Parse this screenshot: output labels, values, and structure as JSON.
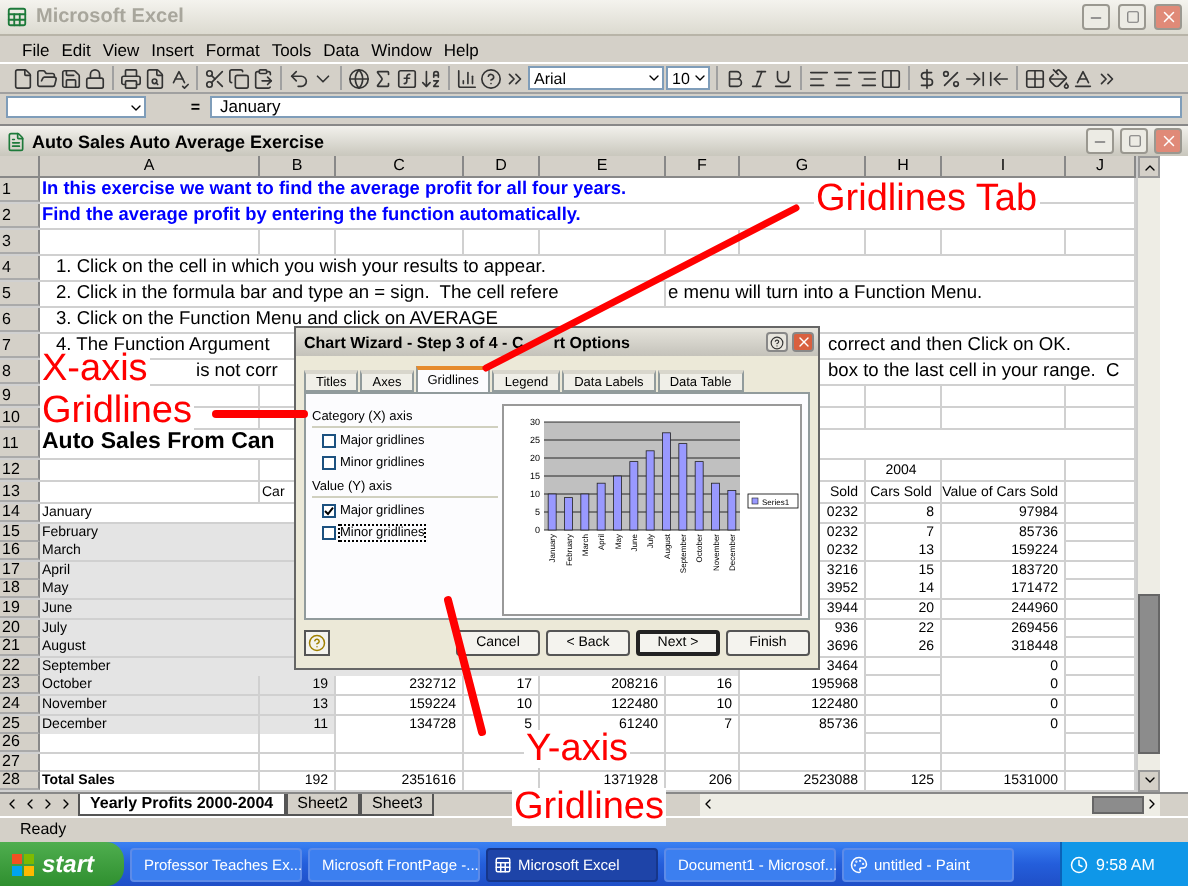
{
  "window": {
    "title": "Microsoft Excel"
  },
  "menu": [
    "File",
    "Edit",
    "View",
    "Insert",
    "Format",
    "Tools",
    "Data",
    "Window",
    "Help"
  ],
  "toolbar": {
    "font": "Arial",
    "size": "10"
  },
  "formula_bar": {
    "equals": "=",
    "value": "January"
  },
  "workbook": {
    "title": "Auto Sales Auto Average Exercise"
  },
  "columns": [
    "A",
    "B",
    "C",
    "D",
    "E",
    "F",
    "G",
    "H",
    "I",
    "J"
  ],
  "rows": [
    {
      "number": "1",
      "kind": "wide",
      "cells": [
        {
          "kind": "heading",
          "text": "In this exercise we want to find the average profit for all four years."
        }
      ]
    },
    {
      "number": "2",
      "kind": "wide",
      "cells": [
        {
          "kind": "heading",
          "text": "Find the average profit by entering the function automatically."
        }
      ]
    },
    {
      "number": "3",
      "kind": "wide"
    },
    {
      "number": "4",
      "kind": "wide",
      "cells": [
        {
          "kind": "step",
          "text": "1. Click on the cell in which you wish your results to appear."
        }
      ]
    },
    {
      "number": "5",
      "kind": "wide",
      "cells": [
        {
          "kind": "step",
          "text": "2. Click in the formula bar and type an = sign.  The cell refere"
        },
        {
          "kind": "blank"
        },
        {
          "kind": "blank"
        },
        {
          "kind": "blank"
        },
        {
          "kind": "blank"
        },
        {
          "kind": "tail",
          "text": "e menu will turn into a Function Menu."
        }
      ]
    },
    {
      "number": "6",
      "kind": "wide",
      "cells": [
        {
          "kind": "step",
          "text": "3. Click on the Function Menu and click on AVERAGE"
        }
      ]
    },
    {
      "number": "7",
      "kind": "wide",
      "cells": [
        {
          "kind": "step",
          "text": "4. The Function Argument"
        },
        {
          "kind": "blank"
        },
        {
          "kind": "blank"
        },
        {
          "kind": "blank"
        },
        {
          "kind": "blank"
        },
        {
          "kind": "blank"
        },
        {
          "kind": "after-dialog",
          "text": "correct and then Click on OK."
        }
      ]
    },
    {
      "number": "8",
      "kind": "wide",
      "cells": [
        {
          "kind": "after-label",
          "text": "is not corr"
        },
        {
          "kind": "blank"
        },
        {
          "kind": "blank"
        },
        {
          "kind": "blank"
        },
        {
          "kind": "blank"
        },
        {
          "kind": "blank"
        },
        {
          "kind": "after-dialog",
          "text": "box to the last cell in your range.  C"
        }
      ]
    },
    {
      "number": "9",
      "kind": "mid"
    },
    {
      "number": "10",
      "kind": "mid"
    },
    {
      "number": "11",
      "kind": "title",
      "cells": [
        {
          "kind": "title",
          "text": "Auto Sales From Can"
        }
      ]
    },
    {
      "number": "12",
      "kind": "mid",
      "cells": [
        {
          "kind": "blank"
        },
        {
          "kind": "blank"
        },
        {
          "kind": "blank"
        },
        {
          "kind": "blank"
        },
        {
          "kind": "blank"
        },
        {
          "kind": "blank"
        },
        {
          "kind": "blank"
        },
        {
          "kind": "center",
          "text": "2004"
        }
      ]
    },
    {
      "number": "13",
      "kind": "mid",
      "cells": [
        {
          "kind": "blank"
        },
        {
          "kind": "label",
          "text": "Car"
        },
        {
          "kind": "blank"
        },
        {
          "kind": "blank"
        },
        {
          "kind": "blank"
        },
        {
          "kind": "blank"
        },
        {
          "kind": "number",
          "text": "Sold"
        },
        {
          "kind": "center",
          "text": "Cars Sold"
        },
        {
          "kind": "number",
          "text": "Value of Cars Sold"
        }
      ]
    },
    {
      "number": "14",
      "kind": "data",
      "in_selection": false,
      "cells": [
        {
          "kind": "label",
          "text": "January"
        },
        {
          "kind": "blank"
        },
        {
          "kind": "blank"
        },
        {
          "kind": "blank"
        },
        {
          "kind": "blank"
        },
        {
          "kind": "blank"
        },
        {
          "kind": "number",
          "text": "0232"
        },
        {
          "kind": "number",
          "text": "8"
        },
        {
          "kind": "number",
          "text": "97984"
        }
      ]
    },
    {
      "number": "15",
      "kind": "data",
      "in_selection": true,
      "cells": [
        {
          "kind": "label",
          "text": "February"
        },
        {
          "kind": "blank"
        },
        {
          "kind": "blank"
        },
        {
          "kind": "blank"
        },
        {
          "kind": "blank"
        },
        {
          "kind": "blank"
        },
        {
          "kind": "number",
          "text": "0232"
        },
        {
          "kind": "number",
          "text": "7"
        },
        {
          "kind": "number",
          "text": "85736"
        }
      ]
    },
    {
      "number": "16",
      "kind": "data",
      "in_selection": true,
      "cells": [
        {
          "kind": "label",
          "text": "March"
        },
        {
          "kind": "blank"
        },
        {
          "kind": "blank"
        },
        {
          "kind": "blank"
        },
        {
          "kind": "blank"
        },
        {
          "kind": "blank"
        },
        {
          "kind": "number",
          "text": "0232"
        },
        {
          "kind": "number",
          "text": "13"
        },
        {
          "kind": "number",
          "text": "159224"
        }
      ]
    },
    {
      "number": "17",
      "kind": "data",
      "in_selection": true,
      "cells": [
        {
          "kind": "label",
          "text": "April"
        },
        {
          "kind": "blank"
        },
        {
          "kind": "blank"
        },
        {
          "kind": "blank"
        },
        {
          "kind": "blank"
        },
        {
          "kind": "blank"
        },
        {
          "kind": "number",
          "text": "3216"
        },
        {
          "kind": "number",
          "text": "15"
        },
        {
          "kind": "number",
          "text": "183720"
        }
      ]
    },
    {
      "number": "18",
      "kind": "data",
      "in_selection": true,
      "cells": [
        {
          "kind": "label",
          "text": "May"
        },
        {
          "kind": "blank"
        },
        {
          "kind": "blank"
        },
        {
          "kind": "blank"
        },
        {
          "kind": "blank"
        },
        {
          "kind": "blank"
        },
        {
          "kind": "number",
          "text": "3952"
        },
        {
          "kind": "number",
          "text": "14"
        },
        {
          "kind": "number",
          "text": "171472"
        }
      ]
    },
    {
      "number": "19",
      "kind": "data",
      "in_selection": true,
      "cells": [
        {
          "kind": "label",
          "text": "June"
        },
        {
          "kind": "blank"
        },
        {
          "kind": "blank"
        },
        {
          "kind": "blank"
        },
        {
          "kind": "blank"
        },
        {
          "kind": "blank"
        },
        {
          "kind": "number",
          "text": "3944"
        },
        {
          "kind": "number",
          "text": "20"
        },
        {
          "kind": "number",
          "text": "244960"
        }
      ]
    },
    {
      "number": "20",
      "kind": "data",
      "in_selection": true,
      "cells": [
        {
          "kind": "label",
          "text": "July"
        },
        {
          "kind": "blank"
        },
        {
          "kind": "blank"
        },
        {
          "kind": "blank"
        },
        {
          "kind": "blank"
        },
        {
          "kind": "blank"
        },
        {
          "kind": "number",
          "text": "936"
        },
        {
          "kind": "number",
          "text": "22"
        },
        {
          "kind": "number",
          "text": "269456"
        }
      ]
    },
    {
      "number": "21",
      "kind": "data",
      "in_selection": true,
      "cells": [
        {
          "kind": "label",
          "text": "August"
        },
        {
          "kind": "blank"
        },
        {
          "kind": "blank"
        },
        {
          "kind": "blank"
        },
        {
          "kind": "blank"
        },
        {
          "kind": "blank"
        },
        {
          "kind": "number",
          "text": "3696"
        },
        {
          "kind": "number",
          "text": "26"
        },
        {
          "kind": "number",
          "text": "318448"
        }
      ]
    },
    {
      "number": "22",
      "kind": "data",
      "in_selection": true,
      "cells": [
        {
          "kind": "label",
          "text": "September"
        },
        {
          "kind": "blank"
        },
        {
          "kind": "blank"
        },
        {
          "kind": "blank"
        },
        {
          "kind": "blank"
        },
        {
          "kind": "blank"
        },
        {
          "kind": "number",
          "text": "3464"
        },
        {
          "kind": "blank"
        },
        {
          "kind": "number",
          "text": "0"
        }
      ]
    },
    {
      "number": "23",
      "kind": "data",
      "in_selection": true,
      "cells": [
        {
          "kind": "label",
          "text": "October"
        },
        {
          "kind": "number",
          "text": "19"
        },
        {
          "kind": "number",
          "text": "232712"
        },
        {
          "kind": "number",
          "text": "17"
        },
        {
          "kind": "number",
          "text": "208216"
        },
        {
          "kind": "number",
          "text": "16"
        },
        {
          "kind": "number",
          "text": "195968"
        },
        {
          "kind": "blank"
        },
        {
          "kind": "number",
          "text": "0"
        }
      ]
    },
    {
      "number": "24",
      "kind": "data",
      "in_selection": true,
      "cells": [
        {
          "kind": "label",
          "text": "November"
        },
        {
          "kind": "number",
          "text": "13"
        },
        {
          "kind": "number",
          "text": "159224"
        },
        {
          "kind": "number",
          "text": "10"
        },
        {
          "kind": "number",
          "text": "122480"
        },
        {
          "kind": "number",
          "text": "10"
        },
        {
          "kind": "number",
          "text": "122480"
        },
        {
          "kind": "blank"
        },
        {
          "kind": "number",
          "text": "0"
        }
      ]
    },
    {
      "number": "25",
      "kind": "data",
      "in_selection": true,
      "cells": [
        {
          "kind": "label",
          "text": "December"
        },
        {
          "kind": "number",
          "text": "11"
        },
        {
          "kind": "number",
          "text": "134728"
        },
        {
          "kind": "number",
          "text": "5"
        },
        {
          "kind": "number",
          "text": "61240"
        },
        {
          "kind": "number",
          "text": "7"
        },
        {
          "kind": "number",
          "text": "85736"
        },
        {
          "kind": "blank"
        },
        {
          "kind": "number",
          "text": "0"
        }
      ]
    },
    {
      "number": "26",
      "kind": "data"
    },
    {
      "number": "27",
      "kind": "data"
    },
    {
      "number": "28",
      "kind": "data",
      "cells": [
        {
          "kind": "bold-label",
          "text": "Total Sales"
        },
        {
          "kind": "number",
          "text": "192"
        },
        {
          "kind": "number",
          "text": "2351616"
        },
        {
          "kind": "blank"
        },
        {
          "kind": "number",
          "text": "1371928"
        },
        {
          "kind": "number",
          "text": "206"
        },
        {
          "kind": "number",
          "text": "2523088"
        },
        {
          "kind": "number",
          "text": "125"
        },
        {
          "kind": "number",
          "text": "1531000"
        }
      ]
    }
  ],
  "sheet_tabs": [
    {
      "label": "Yearly Profits 2000-2004",
      "selected": true
    },
    {
      "label": "Sheet2",
      "selected": false
    },
    {
      "label": "Sheet3",
      "selected": false
    }
  ],
  "status_bar": {
    "text": "Ready"
  },
  "dialog": {
    "title": [
      "Chart Wizard - Step 3 of 4 - C",
      "rt Options"
    ],
    "tabs": [
      {
        "label": "Titles",
        "selected": false
      },
      {
        "label": "Axes",
        "selected": false
      },
      {
        "label": "Gridlines",
        "selected": true
      },
      {
        "label": "Legend",
        "selected": false
      },
      {
        "label": "Data Labels",
        "selected": false
      },
      {
        "label": "Data Table",
        "selected": false
      }
    ],
    "groups": [
      {
        "title": "Category (X) axis",
        "options": [
          {
            "label": "Major gridlines",
            "checked": false,
            "focused": false
          },
          {
            "label": "Minor gridlines",
            "checked": false,
            "focused": false
          }
        ]
      },
      {
        "title": "Value (Y) axis",
        "options": [
          {
            "label": "Major gridlines",
            "checked": true,
            "focused": false
          },
          {
            "label": "Minor gridlines",
            "checked": false,
            "focused": true
          }
        ]
      }
    ],
    "chart_data": {
      "type": "bar",
      "grid": true,
      "categories": [
        "January",
        "February",
        "March",
        "April",
        "May",
        "June",
        "July",
        "August",
        "September",
        "October",
        "November",
        "December"
      ],
      "series": [
        {
          "name": "Series1",
          "color": "#9999ff",
          "values": [
            10,
            9,
            10,
            13,
            15,
            19,
            22,
            27,
            24,
            19,
            13,
            11
          ]
        }
      ],
      "ylim": [
        0,
        30
      ],
      "yticks": [
        {
          "value": 0,
          "label": "0"
        },
        {
          "value": 5,
          "label": "5"
        },
        {
          "value": 10,
          "label": "10"
        },
        {
          "value": 15,
          "label": "15"
        },
        {
          "value": 20,
          "label": "20"
        },
        {
          "value": 25,
          "label": "25"
        },
        {
          "value": 30,
          "label": "30"
        }
      ]
    },
    "buttons": [
      {
        "label": "Cancel",
        "default": false
      },
      {
        "label": "< Back",
        "default": false
      },
      {
        "label": "Next >",
        "default": true
      },
      {
        "label": "Finish",
        "default": false
      }
    ]
  },
  "annotations": [
    {
      "text": "Gridlines Tab"
    },
    {
      "text": "X-axis"
    },
    {
      "text": "Gridlines"
    },
    {
      "text": "Y-axis"
    },
    {
      "text": "Gridlines"
    }
  ],
  "taskbar": {
    "start": "start",
    "items": [
      {
        "label": "Professor Teaches Ex...",
        "selected": false
      },
      {
        "label": "Microsoft FrontPage -...",
        "selected": false
      },
      {
        "label": "Microsoft Excel",
        "selected": true
      },
      {
        "label": "Document1 - Microsof...",
        "selected": false
      },
      {
        "label": "untitled - Paint",
        "selected": false
      }
    ],
    "clock": "9:58 AM"
  }
}
